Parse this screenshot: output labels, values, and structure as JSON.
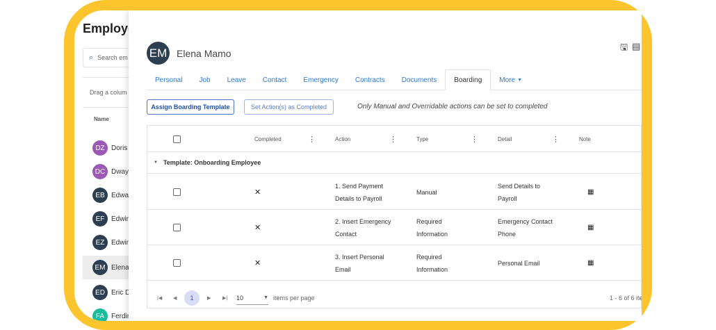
{
  "background_list": {
    "title": "Employe",
    "search_placeholder": "Search em",
    "drag_hint": "Drag a colum",
    "name_header": "Name",
    "rows": [
      {
        "initials": "DZ",
        "name": "Doris",
        "color": "#9b59b6"
      },
      {
        "initials": "DC",
        "name": "Dway",
        "color": "#9b59b6"
      },
      {
        "initials": "EB",
        "name": "Edwa",
        "color": "#2c3e50"
      },
      {
        "initials": "EF",
        "name": "Edwin",
        "color": "#2c3e50"
      },
      {
        "initials": "EZ",
        "name": "Edwin",
        "color": "#2c3e50"
      },
      {
        "initials": "EM",
        "name": "Elena",
        "color": "#2c3e50",
        "selected": true
      },
      {
        "initials": "ED",
        "name": "Eric D",
        "color": "#2c3e50"
      },
      {
        "initials": "FA",
        "name": "Ferdin",
        "color": "#1abc9c"
      }
    ]
  },
  "employee": {
    "initials": "EM",
    "name": "Elena Mamo"
  },
  "tabs": [
    {
      "label": "Personal"
    },
    {
      "label": "Job"
    },
    {
      "label": "Leave"
    },
    {
      "label": "Contact"
    },
    {
      "label": "Emergency"
    },
    {
      "label": "Contracts"
    },
    {
      "label": "Documents"
    },
    {
      "label": "Boarding",
      "active": true
    },
    {
      "label": "More",
      "dropdown": true
    }
  ],
  "toolbar": {
    "assign_label": "Assign Boarding Template",
    "set_completed_label": "Set Action(s) as Completed",
    "note": "Only Manual and Overridable actions can be set to completed"
  },
  "grid": {
    "columns": {
      "completed": "Completed",
      "action": "Action",
      "type": "Type",
      "detail": "Detail",
      "note": "Note"
    },
    "group_label": "Template: Onboarding Employee",
    "rows": [
      {
        "completed": "✕",
        "action_lines": [
          "1. Send Payment",
          "Details to Payroll"
        ],
        "type_lines": [
          "Manual"
        ],
        "detail_lines": [
          "Send Details to",
          "Payroll"
        ]
      },
      {
        "completed": "✕",
        "action_lines": [
          "2. Insert Emergency",
          "Contact"
        ],
        "type_lines": [
          "Required",
          "Information"
        ],
        "detail_lines": [
          "Emergency Contact",
          "Phone"
        ]
      },
      {
        "completed": "✕",
        "action_lines": [
          "3. Insert Personal",
          "Email"
        ],
        "type_lines": [
          "Required",
          "Information"
        ],
        "detail_lines": [
          "Personal Email"
        ]
      }
    ]
  },
  "pager": {
    "current_page": "1",
    "per_page": "10",
    "per_page_label": "items per page",
    "range": "1 - 6 of 6 ite"
  },
  "colors": {
    "frame": "#fcc42d",
    "accent": "#2a7ad6",
    "button_border": "#4a72c6"
  }
}
